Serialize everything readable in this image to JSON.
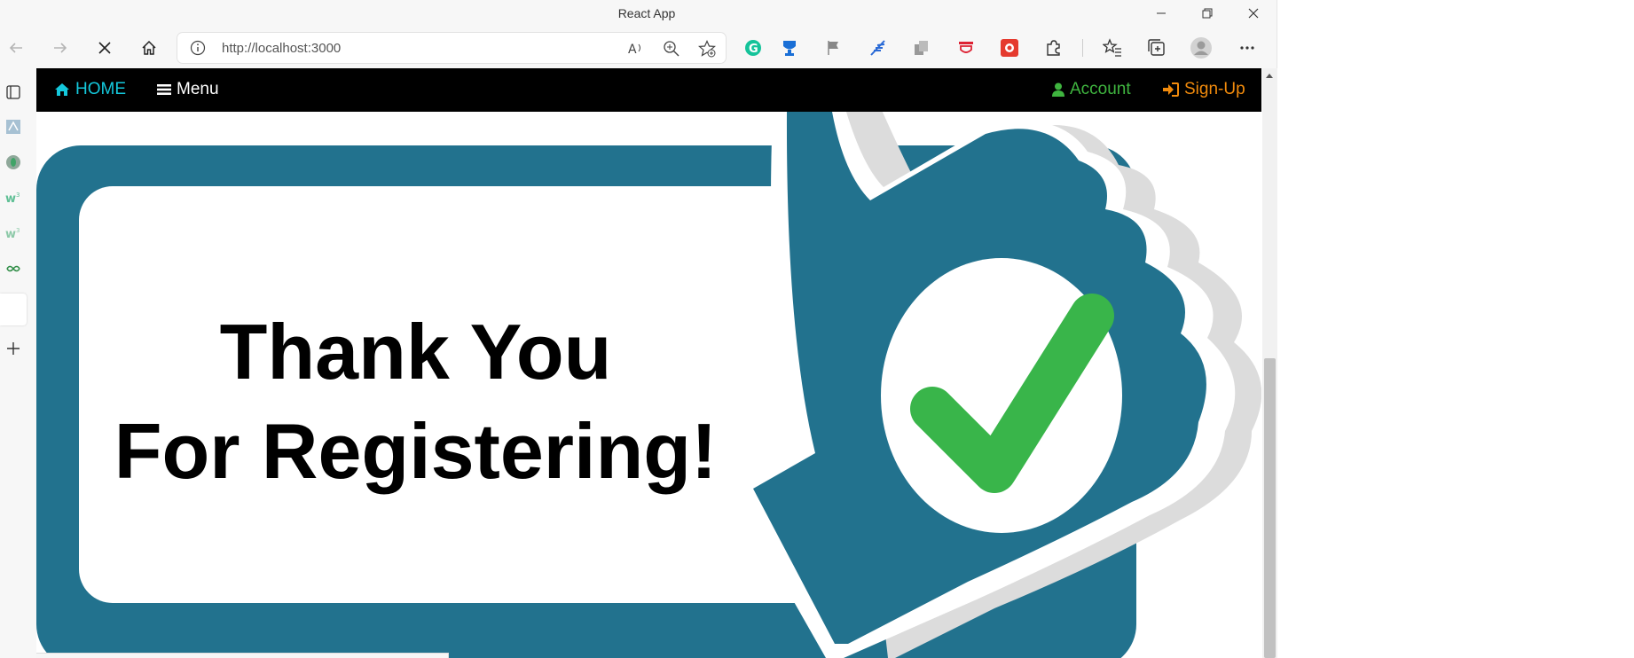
{
  "window": {
    "title": "React App"
  },
  "addressbar": {
    "url": "http://localhost:3000"
  },
  "navbar": {
    "home_label": "HOME",
    "menu_label": "Menu",
    "account_label": "Account",
    "signup_label": "Sign-Up"
  },
  "hero": {
    "line1": "Thank You",
    "line2": "For Registering!"
  },
  "colors": {
    "navbar_bg": "#000000",
    "home": "#14c8dc",
    "account": "#3fb43f",
    "signup": "#f08a0c",
    "badge_teal": "#22728e",
    "check_green": "#39b54a"
  },
  "icons": [
    "back-icon",
    "forward-icon",
    "stop-icon",
    "home-icon",
    "info-icon",
    "read-aloud-icon",
    "zoom-icon",
    "favorite-add-icon",
    "grammarly-icon",
    "extension-icons",
    "favorites-icon",
    "collections-icon",
    "profile-icon",
    "more-icon",
    "home-glyph",
    "bars-icon",
    "user-icon",
    "sign-in-icon",
    "checkmark-icon"
  ]
}
